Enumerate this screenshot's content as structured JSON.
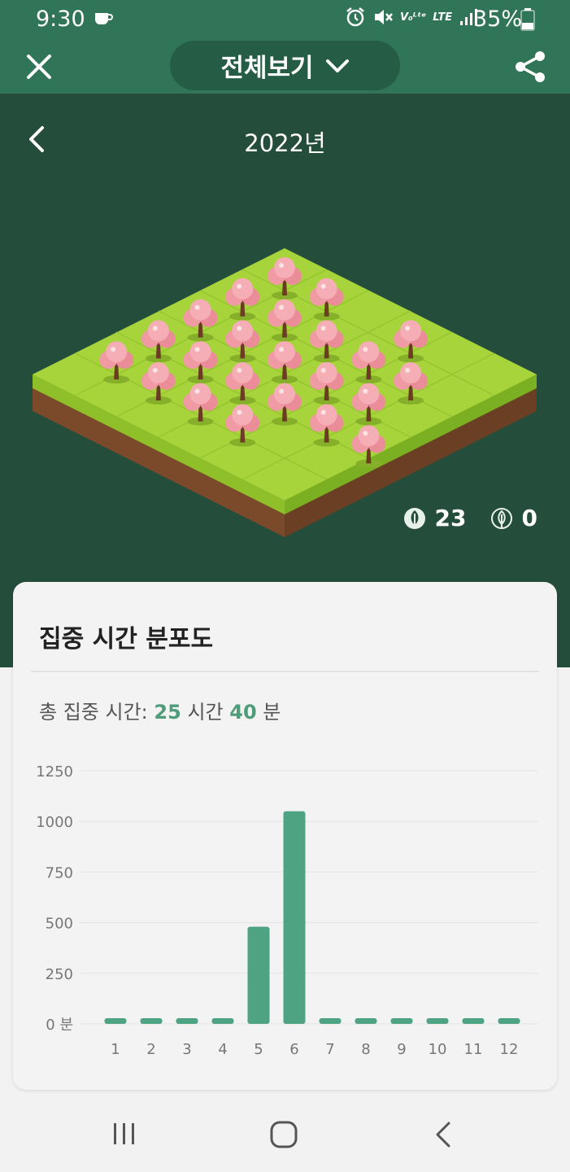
{
  "status_bar": {
    "time": "9:30",
    "network": "LTE",
    "battery": "35%"
  },
  "app_bar": {
    "view_selector_label": "전체보기"
  },
  "hero": {
    "year_label": "2022년",
    "trees_alive_count": "23",
    "trees_dead_count": "0"
  },
  "card": {
    "title": "집중 시간 분포도",
    "total_prefix": "총 집중 시간:",
    "hours": "25",
    "hours_unit": "시간",
    "minutes": "40",
    "minutes_unit": "분"
  },
  "chart_data": {
    "type": "bar",
    "categories": [
      "1",
      "2",
      "3",
      "4",
      "5",
      "6",
      "7",
      "8",
      "9",
      "10",
      "11",
      "12"
    ],
    "values": [
      0,
      0,
      0,
      0,
      480,
      1050,
      0,
      0,
      0,
      0,
      0,
      0
    ],
    "ylim": [
      0,
      1250
    ],
    "yticks": [
      "0 분",
      "250",
      "500",
      "750",
      "1000",
      "1250"
    ],
    "bar_color": "#4ea382",
    "grid": true
  },
  "colors": {
    "brand_green": "#307558",
    "hero_dark": "#244d3b",
    "accent": "#4e9c7a"
  },
  "nav_bar": {
    "recents_icon": "recents-icon",
    "home_icon": "home-icon",
    "back_icon": "back-icon"
  }
}
